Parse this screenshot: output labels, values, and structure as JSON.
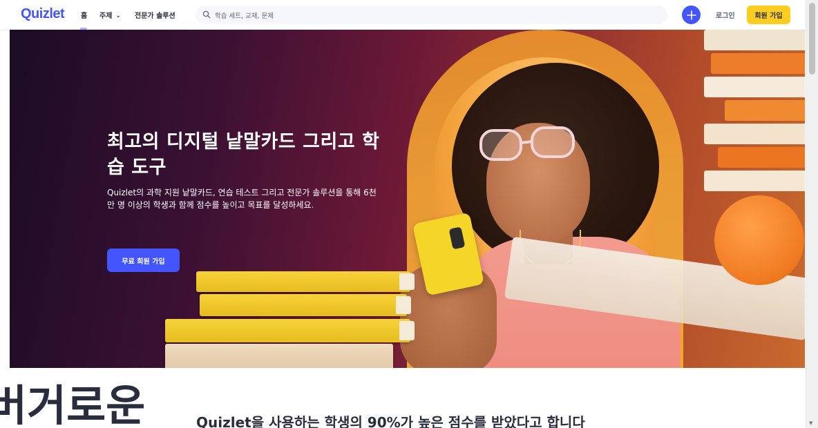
{
  "nav": {
    "logo": "Quizlet",
    "home": "홈",
    "topics": "주제",
    "topics_chevron": "⌄",
    "expert": "전문가 솔루션",
    "search_placeholder": "학습 세트, 교재, 문제",
    "create_icon": "plus-icon",
    "login": "로그인",
    "signup": "회원 가입"
  },
  "hero": {
    "title": "최고의 디지털 낱말카드 그리고 학습 도구",
    "description": "Quizlet의 과학 지원 낱말카드, 연습 테스트 그리고 전문가 솔루션을 통해 6천만 명 이상의 학생과 함께 점수를 높이고 목표를 달성하세요.",
    "cta": "무료 회원 가입"
  },
  "section": {
    "heading_fragment": "버거로운",
    "stat": "Quizlet을 사용하는 학생의 90%가 높은 점수를 받았다고 합니다"
  },
  "colors": {
    "brand": "#4255ff",
    "signup_button": "#ffcd1f",
    "text": "#282e3e"
  }
}
